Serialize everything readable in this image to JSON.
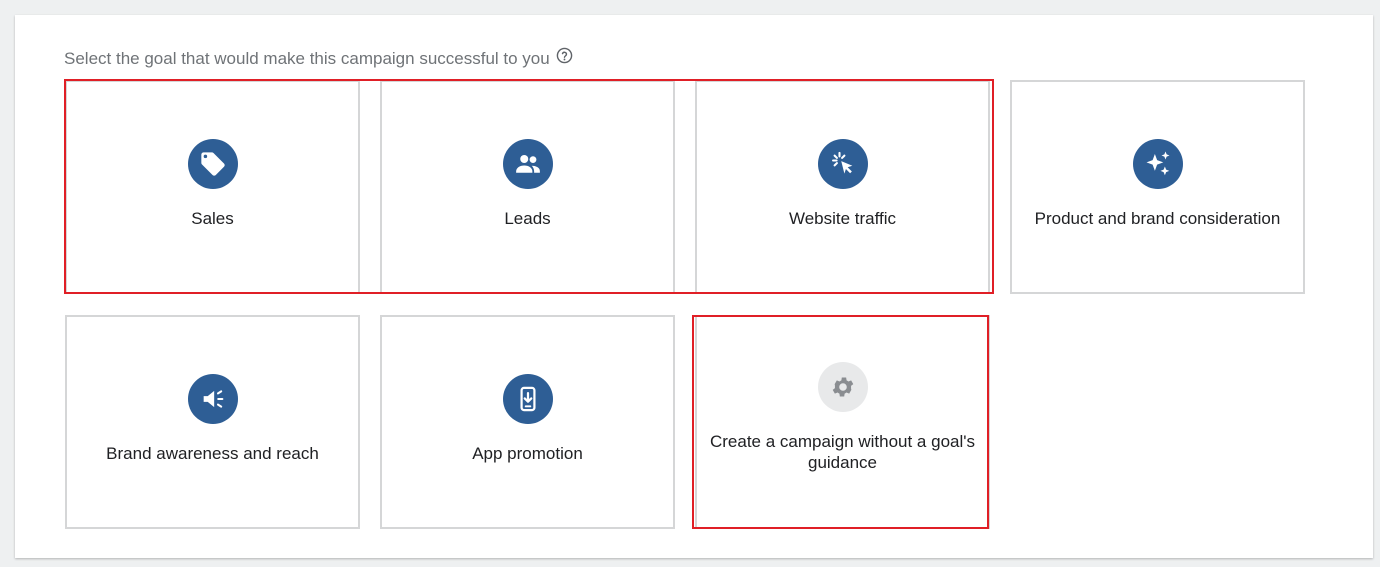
{
  "prompt": {
    "text": "Select the goal that would make this campaign successful to you",
    "help_icon": "question-circle-icon"
  },
  "goals": [
    {
      "label": "Sales",
      "icon": "price-tag-icon"
    },
    {
      "label": "Leads",
      "icon": "people-icon"
    },
    {
      "label": "Website traffic",
      "icon": "cursor-click-icon"
    },
    {
      "label": "Product and brand consideration",
      "icon": "sparkle-icon"
    },
    {
      "label": "Brand awareness and reach",
      "icon": "megaphone-icon"
    },
    {
      "label": "App promotion",
      "icon": "phone-download-icon"
    },
    {
      "label": "Create a campaign without a goal's guidance",
      "icon": "gear-icon"
    }
  ],
  "colors": {
    "icon_blue": "#2e5e95",
    "icon_grey_bg": "#e8e9ea",
    "highlight_red": "#e01f26",
    "card_border": "#d5d6d7"
  }
}
